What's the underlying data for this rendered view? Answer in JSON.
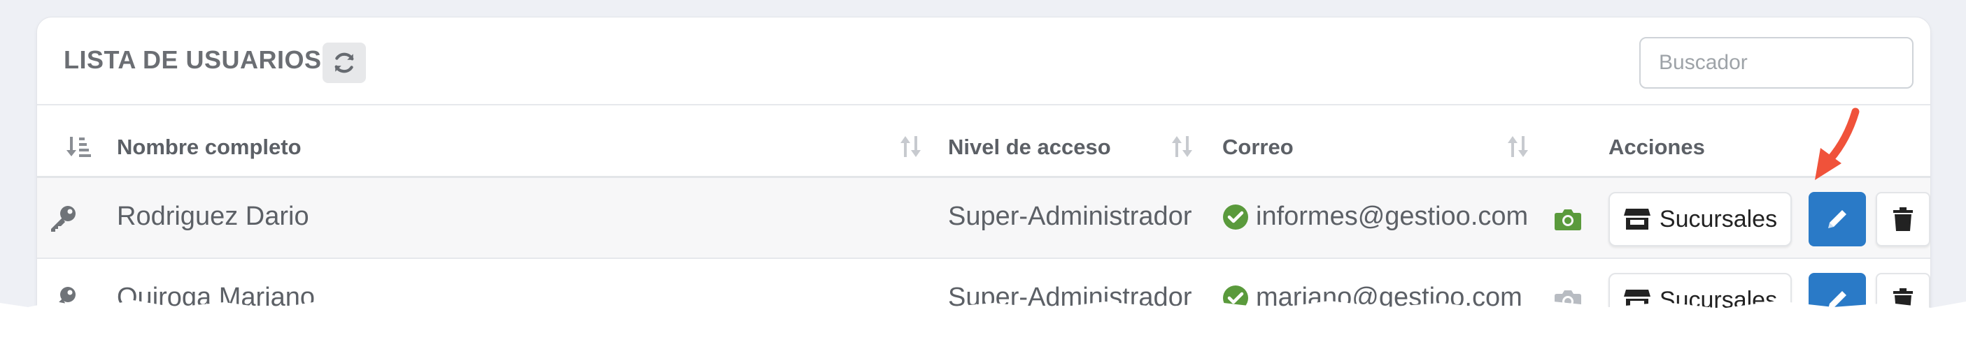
{
  "header": {
    "title": "LISTA DE USUARIOS",
    "refresh_icon": "refresh-icon",
    "search_placeholder": "Buscador"
  },
  "table": {
    "columns": {
      "order": "sort-order-icon",
      "name": "Nombre completo",
      "level": "Nivel de acceso",
      "email": "Correo",
      "actions": "Acciones"
    },
    "rows": [
      {
        "name": "Rodriguez Dario",
        "level": "Super-Administrador",
        "email": "informes@gestioo.com",
        "verified": true,
        "camera_color": "#5a9a3c",
        "branches_label": "Sucursales"
      },
      {
        "name": "Quiroga Mariano",
        "level": "Super-Administrador",
        "email": "mariano@gestioo.com",
        "verified": true,
        "camera_color": "#b8bcc2",
        "branches_label": "Sucursales"
      }
    ]
  },
  "colors": {
    "primary": "#2a7ac7",
    "verified": "#5a9a3c",
    "annotation_arrow": "#f0523a"
  }
}
